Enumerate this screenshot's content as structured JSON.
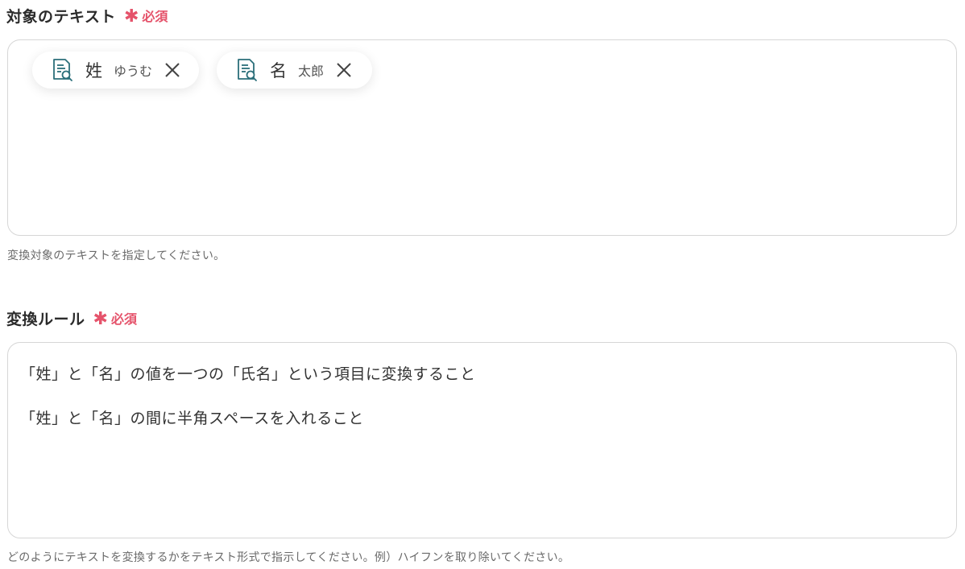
{
  "target_text": {
    "label": "対象のテキスト",
    "required_label": "必須",
    "chips": [
      {
        "name": "姓",
        "value": "ゆうむ",
        "icon": "document-search-icon"
      },
      {
        "name": "名",
        "value": "太郎",
        "icon": "document-search-icon"
      }
    ],
    "help": "変換対象のテキストを指定してください。"
  },
  "conversion_rule": {
    "label": "変換ルール",
    "required_label": "必須",
    "lines": [
      "「姓」と「名」の値を一つの「氏名」という項目に変換すること",
      "「姓」と「名」の間に半角スペースを入れること"
    ],
    "help": "どのようにテキストを変換するかをテキスト形式で指示してください。例）ハイフンを取り除いてください。"
  },
  "colors": {
    "required": "#e5536b",
    "icon": "#2b6f7a",
    "border": "#d6d6d6"
  }
}
